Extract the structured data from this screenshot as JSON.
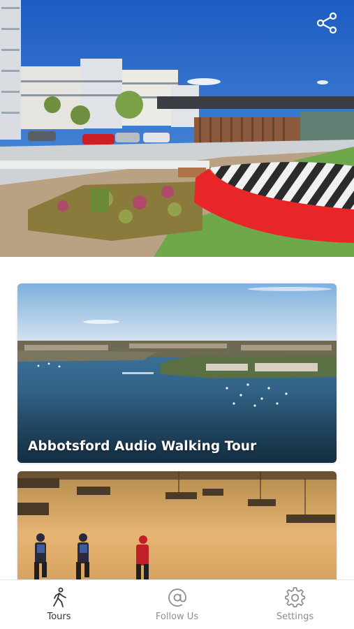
{
  "hero": {
    "image": "urban-park-with-apartments-and-striped-mound",
    "share_icon": "share-icon"
  },
  "tours": [
    {
      "title": "Abbotsford Audio Walking Tour",
      "image": "aerial-bay-with-boats"
    },
    {
      "title": "",
      "image": "runners-at-sunrise-by-marina"
    }
  ],
  "tabbar": {
    "tabs": [
      {
        "label": "Tours",
        "icon": "walking-person-icon",
        "active": true
      },
      {
        "label": "Follow Us",
        "icon": "at-sign-icon",
        "active": false
      },
      {
        "label": "Settings",
        "icon": "gear-icon",
        "active": false
      }
    ]
  },
  "colors": {
    "active_tab": "#333333",
    "inactive_tab": "#8e8e8e",
    "mound_red": "#e8262a",
    "sky": "#2f6fc4"
  }
}
